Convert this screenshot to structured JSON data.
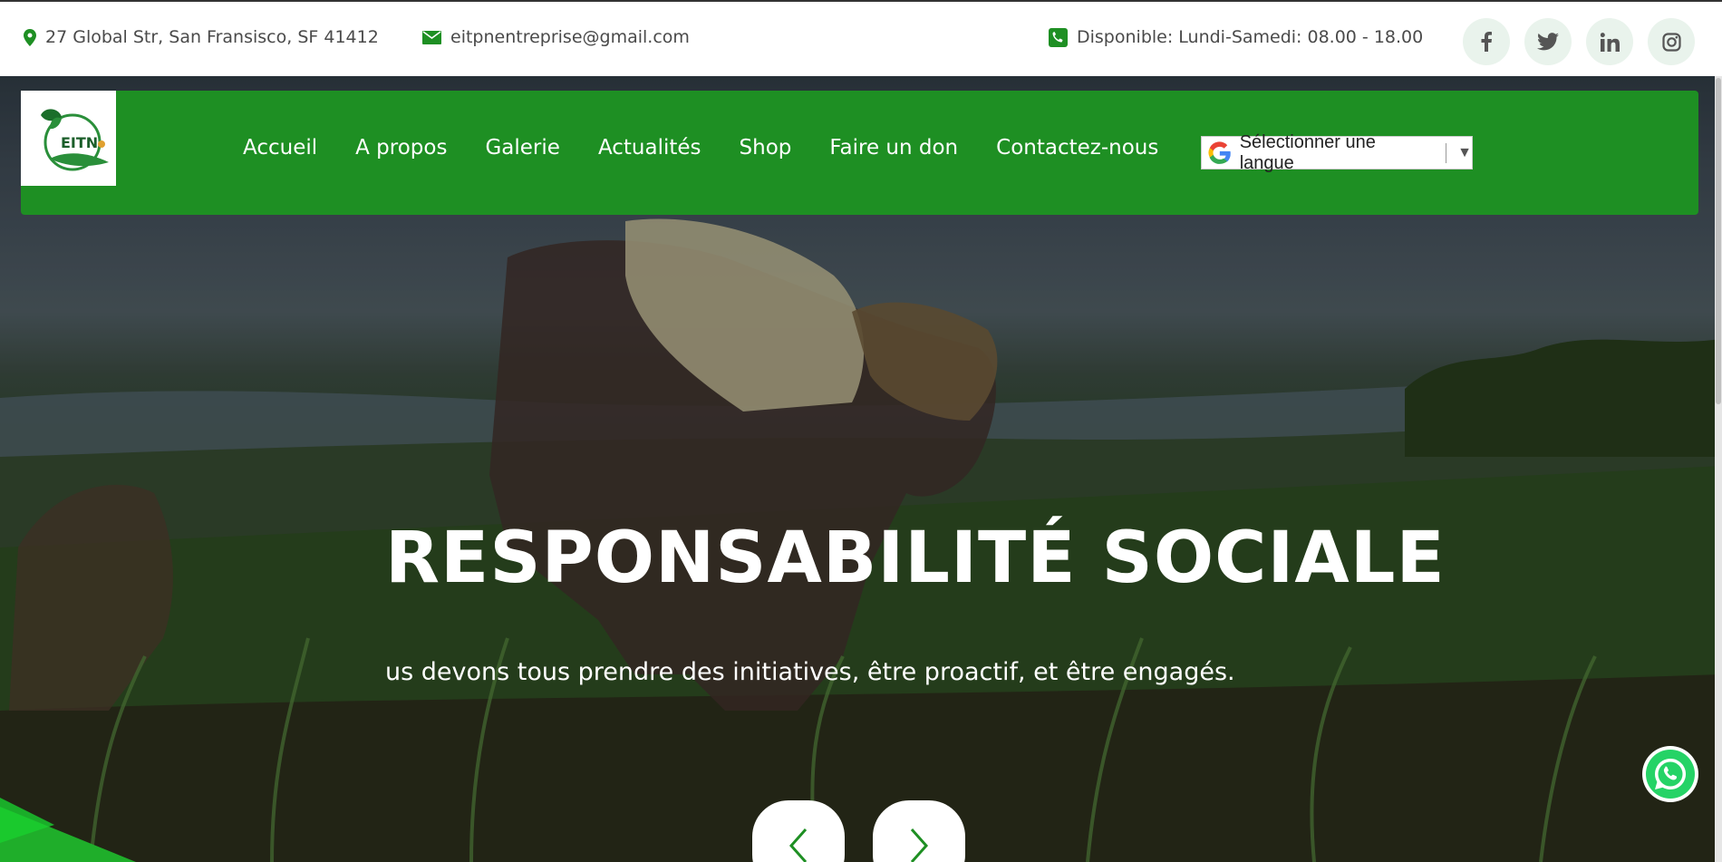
{
  "topbar": {
    "address": "27 Global Str, San Fransisco, SF 41412",
    "email": "eitpnentreprise@gmail.com",
    "hours": "Disponible: Lundi-Samedi: 08.00 - 18.00",
    "socials": [
      "facebook-icon",
      "twitter-icon",
      "linkedin-icon",
      "instagram-icon"
    ]
  },
  "nav": {
    "items": [
      "Accueil",
      "A propos",
      "Galerie",
      "Actualités",
      "Shop",
      "Faire un don",
      "Contactez-nous"
    ],
    "language_label": "Sélectionner une langue"
  },
  "hero": {
    "title": "RESPONSABILITÉ SOCIALE",
    "subtitle": "us devons tous prendre des initiatives, être proactif, et être engagés."
  },
  "colors": {
    "brand_green": "#1e8f23",
    "icon_green": "#1e8f23"
  }
}
